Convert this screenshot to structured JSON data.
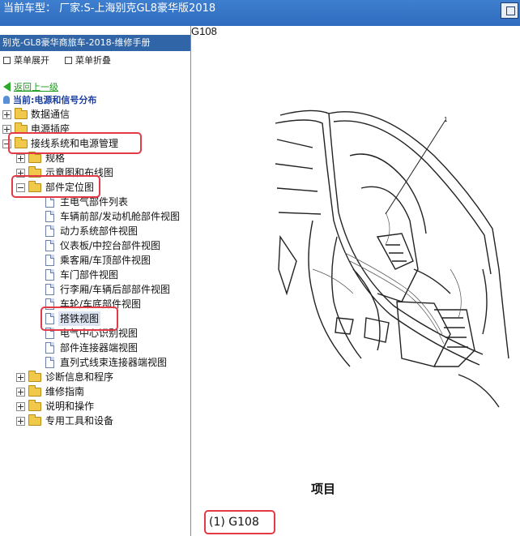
{
  "window": {
    "title": "当前车型： 厂家:S-上海别克GL8豪华版2018"
  },
  "left_panel": {
    "manual_title": "别克-GL8豪华商旅车-2018-维修手册",
    "expand_label": "菜单展开",
    "collapse_label": "菜单折叠",
    "back_label": "返回上一级",
    "current_label": "当前:电源和信号分布",
    "tree": {
      "n1": "数据通信",
      "n2": "电源插座",
      "n3": "接线系统和电源管理",
      "n3_1": "规格",
      "n3_2": "示意图和布线图",
      "n3_3": "部件定位图",
      "n3_3_1": "主电气部件列表",
      "n3_3_2": "车辆前部/发动机舱部件视图",
      "n3_3_3": "动力系统部件视图",
      "n3_3_4": "仪表板/中控台部件视图",
      "n3_3_5": "乘客厢/车顶部件视图",
      "n3_3_6": "车门部件视图",
      "n3_3_7": "行李厢/车辆后部部件视图",
      "n3_3_8": "车轮/车底部件视图",
      "n3_3_9": "搭铁视图",
      "n3_3_10": "电气中心识别视图",
      "n3_3_11": "部件连接器端视图",
      "n3_3_12": "直列式线束连接器端视图",
      "n3_4": "诊断信息和程序",
      "n3_5": "维修指南",
      "n3_6": "说明和操作",
      "n3_7": "专用工具和设备"
    }
  },
  "right_panel": {
    "top_partial": "G108",
    "callout_number": "1",
    "caption": "项目",
    "item": "(1) G108"
  },
  "colors": {
    "title_bar": "#2f6bbf",
    "manual_header": "#3065a8",
    "highlight_box": "#e23b47",
    "folder": "#f1c94a"
  }
}
